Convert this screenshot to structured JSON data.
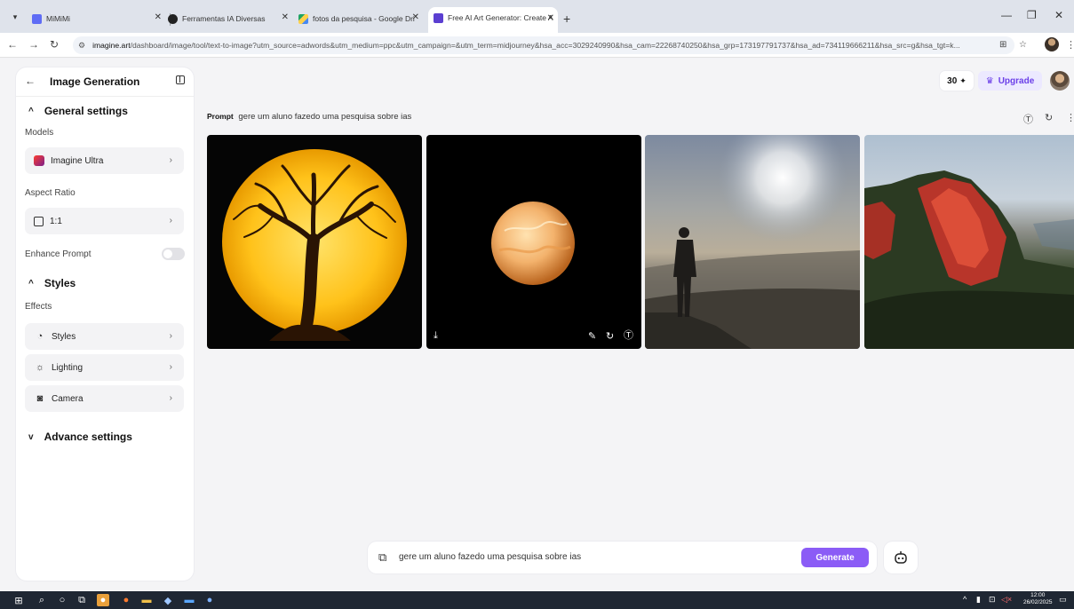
{
  "browser": {
    "tabs": [
      {
        "title": "MiMiMi",
        "favicon_color": "#5f6cf5"
      },
      {
        "title": "Ferramentas IA Diversas",
        "favicon_color": "#222222"
      },
      {
        "title": "fotos da pesquisa - Google Dri",
        "favicon_color": "#1fa463"
      },
      {
        "title": "Free AI Art Generator: Create A",
        "favicon_color": "#5b3fd1"
      }
    ],
    "active_tab_index": 3,
    "url_domain": "imagine.art",
    "url_path": "/dashboard/image/tool/text-to-image?utm_source=adwords&utm_medium=ppc&utm_campaign=&utm_term=midjourney&hsa_acc=3029240990&hsa_cam=22268740250&hsa_grp=173197791737&hsa_ad=734119666211&hsa_src=g&hsa_tgt=k..."
  },
  "sidebar": {
    "title": "Image Generation",
    "general_settings": "General settings",
    "models_label": "Models",
    "model_value": "Imagine Ultra",
    "aspect_ratio_label": "Aspect Ratio",
    "aspect_ratio_value": "1:1",
    "enhance_prompt_label": "Enhance Prompt",
    "enhance_prompt_on": false,
    "styles_section": "Styles",
    "effects_label": "Effects",
    "effects": [
      {
        "label": "Styles",
        "icon": "palette-icon"
      },
      {
        "label": "Lighting",
        "icon": "sun-icon"
      },
      {
        "label": "Camera",
        "icon": "camera-icon"
      }
    ],
    "advance_settings": "Advance settings"
  },
  "header": {
    "credits": "30",
    "upgrade_label": "Upgrade"
  },
  "results": {
    "prompt_label": "Prompt",
    "prompt_text": "gere um aluno fazedo uma pesquisa sobre ias"
  },
  "composer": {
    "prompt_value": "gere um aluno fazedo uma pesquisa sobre ias",
    "generate_label": "Generate"
  },
  "taskbar": {
    "time": "12:00",
    "date": "26/02/2025"
  },
  "colors": {
    "accent": "#8b5cf6",
    "upgrade_text": "#6b3fe8",
    "upgrade_bg": "#ece9ff"
  }
}
